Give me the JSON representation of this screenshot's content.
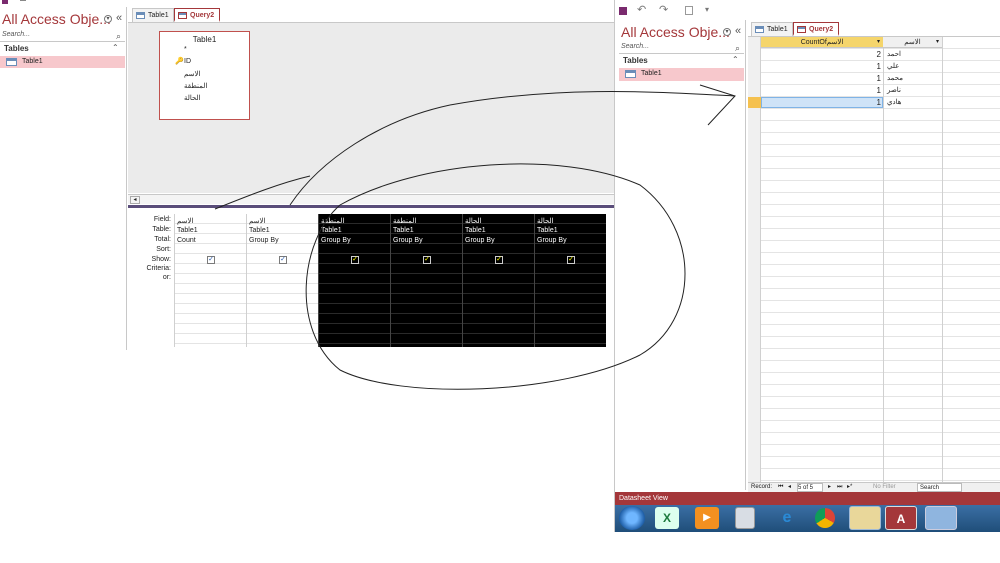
{
  "left": {
    "nav": {
      "title": "All Access Obje...",
      "search_placeholder": "Search...",
      "section": "Tables",
      "items": [
        {
          "label": "Table1"
        }
      ]
    },
    "tabs": [
      {
        "label": "Table1"
      },
      {
        "label": "Query2"
      }
    ],
    "design": {
      "table_box": {
        "title": "Table1",
        "fields": [
          "*",
          "ID",
          "الاسم",
          "المنطقة",
          "الحالة"
        ]
      },
      "row_labels": [
        "Field:",
        "Table:",
        "Total:",
        "Sort:",
        "Show:",
        "Criteria:",
        "or:"
      ],
      "columns": [
        {
          "field": "الاسم",
          "table": "Table1",
          "total": "Count",
          "show": true,
          "highlight": false
        },
        {
          "field": "الاسم",
          "table": "Table1",
          "total": "Group By",
          "show": true,
          "highlight": false
        },
        {
          "field": "المنطقة",
          "table": "Table1",
          "total": "Group By",
          "show": true,
          "highlight": true
        },
        {
          "field": "المنطقة",
          "table": "Table1",
          "total": "Group By",
          "show": true,
          "highlight": true
        },
        {
          "field": "الحالة",
          "table": "Table1",
          "total": "Group By",
          "show": true,
          "highlight": true
        },
        {
          "field": "الحالة",
          "table": "Table1",
          "total": "Group By",
          "show": true,
          "highlight": true
        }
      ]
    }
  },
  "right": {
    "nav": {
      "title": "All Access Obje...",
      "search_placeholder": "Search...",
      "section": "Tables",
      "items": [
        {
          "label": "Table1"
        }
      ]
    },
    "tabs": [
      {
        "label": "Table1"
      },
      {
        "label": "Query2"
      }
    ],
    "datasheet": {
      "headers": [
        "CountOfالاسم",
        "الاسم"
      ],
      "rows": [
        {
          "count": "2",
          "name": "احمد"
        },
        {
          "count": "1",
          "name": "علي"
        },
        {
          "count": "1",
          "name": "محمد"
        },
        {
          "count": "1",
          "name": "ناصر"
        },
        {
          "count": "1",
          "name": "هادي"
        }
      ]
    },
    "record_nav": {
      "label": "Record:",
      "position": "5 of 5",
      "filter": "No Filter",
      "search": "Search"
    },
    "status": "Datasheet View"
  },
  "colors": {
    "access_red": "#a4373a",
    "taskbar": "#1f4e79",
    "selected_row": "#cfe3f7"
  },
  "taskbar_icons": [
    "windows-start-icon",
    "excel-icon",
    "media-player-icon",
    "calculator-icon",
    "internet-explorer-icon",
    "chrome-icon",
    "file-explorer-icon",
    "access-icon",
    "paint-icon"
  ]
}
